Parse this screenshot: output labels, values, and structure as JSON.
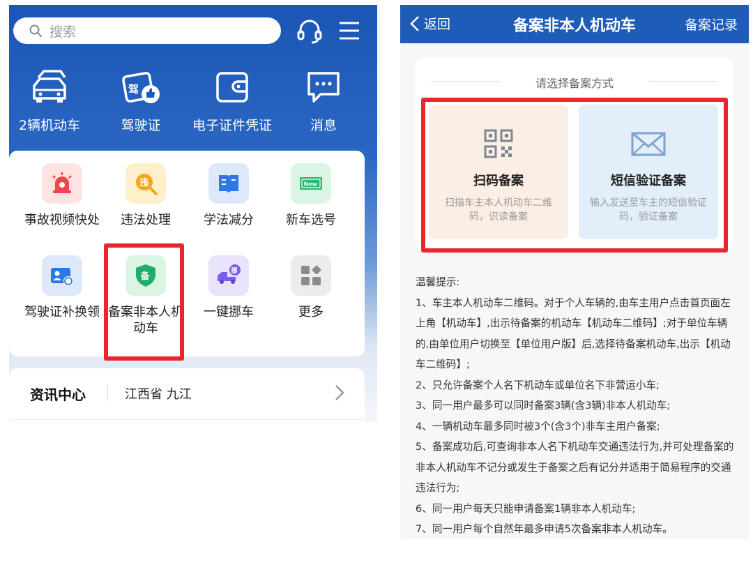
{
  "left": {
    "search_placeholder": "搜索",
    "top_items": [
      {
        "label": "2辆机动车",
        "icon": "car-icon"
      },
      {
        "label": "驾驶证",
        "icon": "license-icon"
      },
      {
        "label": "电子证件凭证",
        "icon": "wallet-icon"
      },
      {
        "label": "消息",
        "icon": "message-icon"
      }
    ],
    "services": [
      {
        "label": "事故视频快处",
        "icon": "siren-icon"
      },
      {
        "label": "违法处理",
        "icon": "violation-search-icon"
      },
      {
        "label": "学法减分",
        "icon": "book-icon"
      },
      {
        "label": "新车选号",
        "icon": "new-plate-icon"
      },
      {
        "label": "驾驶证补换领",
        "icon": "id-card-exchange-icon"
      },
      {
        "label": "备案非本人机动车",
        "icon": "shield-record-icon"
      },
      {
        "label": "一键挪车",
        "icon": "tow-truck-icon"
      },
      {
        "label": "更多",
        "icon": "more-grid-icon"
      }
    ],
    "info_center": {
      "title": "资讯中心",
      "location": "江西省 九江"
    }
  },
  "right": {
    "nav": {
      "back_label": "返回",
      "title": "备案非本人机动车",
      "record_label": "备案记录"
    },
    "prompt": "请选择备案方式",
    "methods": [
      {
        "title": "扫码备案",
        "desc": "扫描车主本人机动车二维码，识读备案",
        "icon": "qr-code-icon"
      },
      {
        "title": "短信验证备案",
        "desc": "输入发送至车主的短信验证码，验证备案",
        "icon": "envelope-icon"
      }
    ],
    "tips": [
      "温馨提示:",
      "1、车主本人机动车二维码。对于个人车辆的,由车主用户点击首页面左上角【机动车】,出示待备案的机动车【机动车二维码】;对于单位车辆的,由单位用户切换至【单位用户版】后,选择待备案机动车,出示【机动车二维码】;",
      "2、只允许备案个人名下机动车或单位名下非营运小车;",
      "3、同一用户最多可以同时备案3辆(含3辆)非本人机动车;",
      "4、一辆机动车最多同时被3个(含3个)非车主用户备案;",
      "5、备案成功后,可查询非本人名下机动车交通违法行为,并可处理备案的非本人机动车不记分或发生于备案之后有记分并适用于简易程序的交通违法行为;",
      "6、同一用户每天只能申请备案1辆非本人机动车;",
      "7、同一用户每个自然年最多申请5次备案非本人机动车。"
    ]
  },
  "colors": {
    "primary_blue": "#1f5cb7",
    "highlight_red": "#e8262d"
  }
}
